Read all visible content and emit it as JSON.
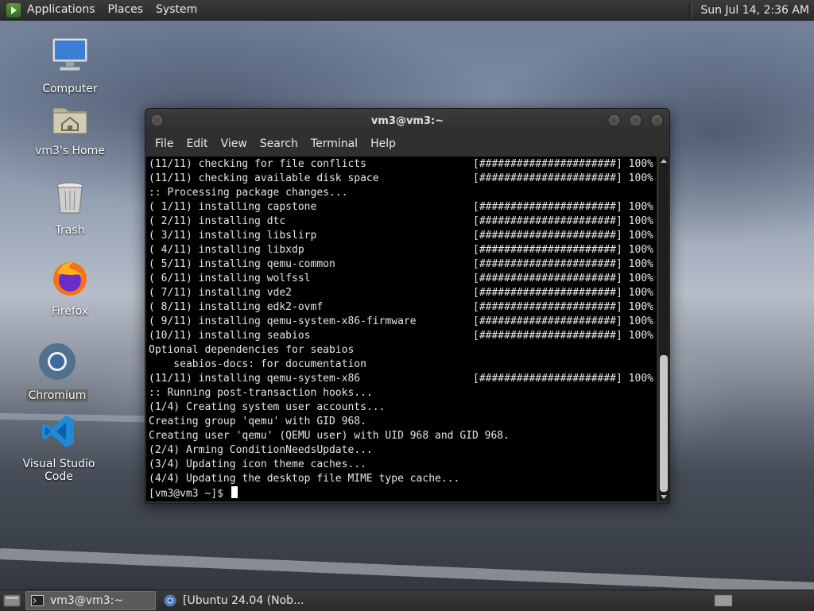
{
  "top_panel": {
    "menus": [
      "Applications",
      "Places",
      "System"
    ],
    "clock": "Sun Jul 14,  2:36 AM"
  },
  "desktop_icons": [
    {
      "label": "Computer",
      "icon": "computer-icon"
    },
    {
      "label": "vm3's Home",
      "icon": "home-folder-icon"
    },
    {
      "label": "Trash",
      "icon": "trash-icon"
    },
    {
      "label": "Firefox",
      "icon": "firefox-icon"
    },
    {
      "label": "Chromium",
      "icon": "chromium-icon",
      "selected": true
    },
    {
      "label": "Visual Studio Code",
      "icon": "vscode-icon"
    }
  ],
  "terminal": {
    "title": "vm3@vm3:~",
    "menu": [
      "File",
      "Edit",
      "View",
      "Search",
      "Terminal",
      "Help"
    ],
    "lines": [
      {
        "text": "(11/11) checking for file conflicts",
        "progress": "[######################] 100%"
      },
      {
        "text": "(11/11) checking available disk space",
        "progress": "[######################] 100%"
      },
      {
        "text": ":: Processing package changes..."
      },
      {
        "text": "( 1/11) installing capstone",
        "progress": "[######################] 100%"
      },
      {
        "text": "( 2/11) installing dtc",
        "progress": "[######################] 100%"
      },
      {
        "text": "( 3/11) installing libslirp",
        "progress": "[######################] 100%"
      },
      {
        "text": "( 4/11) installing libxdp",
        "progress": "[######################] 100%"
      },
      {
        "text": "( 5/11) installing qemu-common",
        "progress": "[######################] 100%"
      },
      {
        "text": "( 6/11) installing wolfssl",
        "progress": "[######################] 100%"
      },
      {
        "text": "( 7/11) installing vde2",
        "progress": "[######################] 100%"
      },
      {
        "text": "( 8/11) installing edk2-ovmf",
        "progress": "[######################] 100%"
      },
      {
        "text": "( 9/11) installing qemu-system-x86-firmware",
        "progress": "[######################] 100%"
      },
      {
        "text": "(10/11) installing seabios",
        "progress": "[######################] 100%"
      },
      {
        "text": "Optional dependencies for seabios"
      },
      {
        "text": "    seabios-docs: for documentation"
      },
      {
        "text": "(11/11) installing qemu-system-x86",
        "progress": "[######################] 100%"
      },
      {
        "text": ":: Running post-transaction hooks..."
      },
      {
        "text": "(1/4) Creating system user accounts..."
      },
      {
        "text": "Creating group 'qemu' with GID 968."
      },
      {
        "text": "Creating user 'qemu' (QEMU user) with UID 968 and GID 968."
      },
      {
        "text": "(2/4) Arming ConditionNeedsUpdate..."
      },
      {
        "text": "(3/4) Updating icon theme caches..."
      },
      {
        "text": "(4/4) Updating the desktop file MIME type cache..."
      }
    ],
    "prompt": "[vm3@vm3 ~]$ "
  },
  "taskbar": {
    "tasks": [
      {
        "label": "vm3@vm3:~",
        "active": true
      },
      {
        "label": "[Ubuntu 24.04 (Nob...",
        "active": false
      }
    ]
  }
}
